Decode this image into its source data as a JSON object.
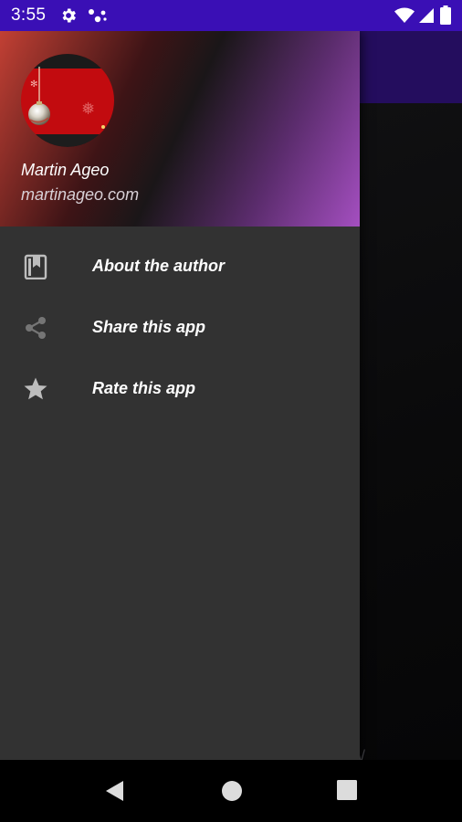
{
  "status_bar": {
    "time": "3:55",
    "icons": [
      "settings-icon",
      "assistant-dots-icon",
      "wifi-icon",
      "signal-icon",
      "battery-icon"
    ],
    "background_color": "#3a0fb5"
  },
  "drawer": {
    "header": {
      "user_name": "Martin Ageo",
      "user_site": "martinageo.com"
    },
    "items": [
      {
        "label": "About the author",
        "icon": "book-icon"
      },
      {
        "label": "Share this app",
        "icon": "share-icon"
      },
      {
        "label": "Rate this app",
        "icon": "star-icon"
      }
    ],
    "background_color": "#323232"
  },
  "background_app": {
    "toolbar_color": "#240d5e",
    "glyph": "\\/"
  },
  "nav_bar": {
    "buttons": [
      "back-icon",
      "home-icon",
      "recents-icon"
    ]
  }
}
